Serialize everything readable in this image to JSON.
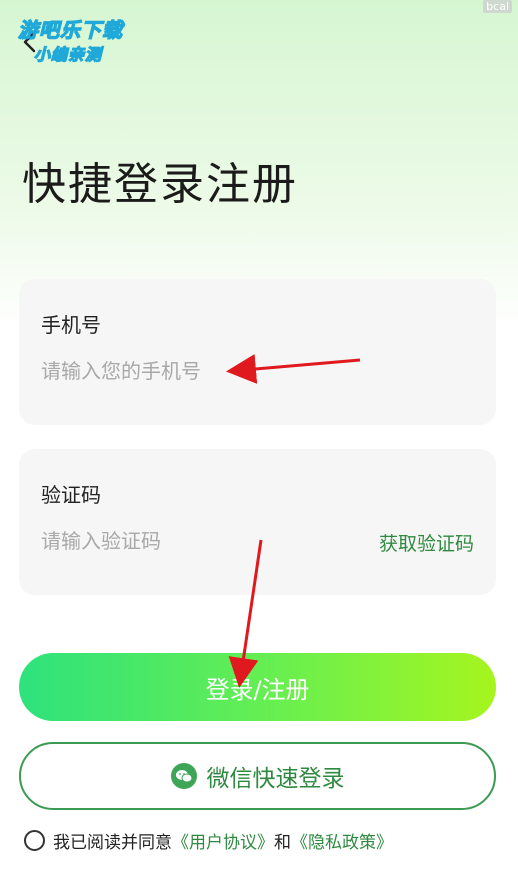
{
  "watermark": {
    "corner": "bcal",
    "line1": "游吧乐下载",
    "line2": "小编亲测"
  },
  "header": {
    "back_icon": "chevron-left-icon"
  },
  "title": "快捷登录注册",
  "phone": {
    "label": "手机号",
    "placeholder": "请输入您的手机号"
  },
  "code": {
    "label": "验证码",
    "placeholder": "请输入验证码",
    "get_code": "获取验证码"
  },
  "login_button": "登录/注册",
  "wechat": {
    "icon": "wechat-icon",
    "label": "微信快速登录"
  },
  "agreement": {
    "prefix": "我已阅读并同意",
    "user_agreement": "《用户协议》",
    "and": "和",
    "privacy_policy": "《隐私政策》"
  },
  "colors": {
    "accent": "#2f8a40",
    "arrow": "#e0191e",
    "button_start": "#2ee27d",
    "button_end": "#a6f51e"
  }
}
